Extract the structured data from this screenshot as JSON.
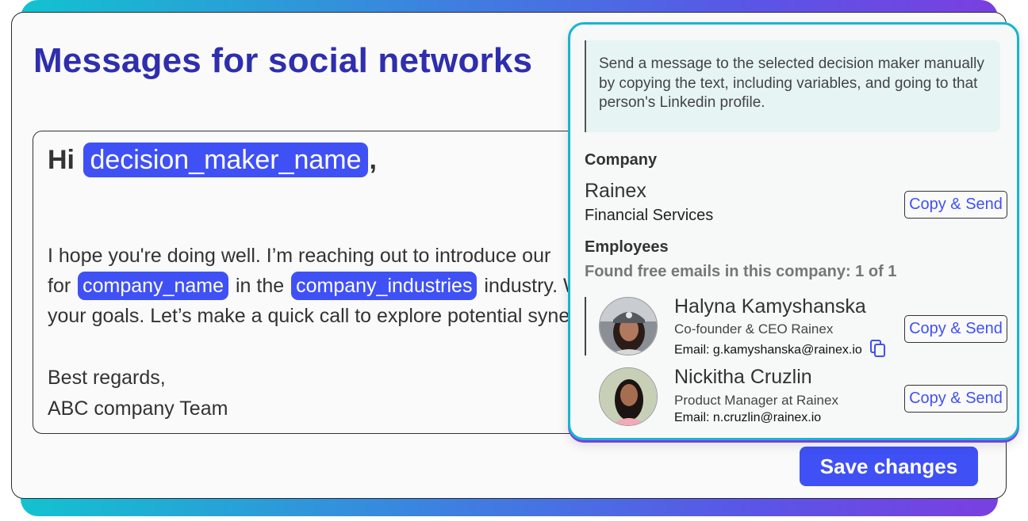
{
  "page": {
    "title": "Messages for social networks"
  },
  "editor": {
    "greeting_prefix": "Hi",
    "greeting_variable": "decision_maker_name",
    "greeting_suffix": ",",
    "line1": "I hope you're doing well. I’m reaching out to introduce our",
    "line2_prefix": "for",
    "line2_var1": "company_name",
    "line2_middle": "in the",
    "line2_var2": "company_industries",
    "line2_suffix": " industry. We can help you achieve",
    "line3": "your goals. Let’s make a quick call to explore potential synergies.",
    "signoff": "Best regards,",
    "signature": "ABC company Team"
  },
  "actions": {
    "save_label": "Save changes"
  },
  "panel": {
    "hint": "Send a message to the selected decision maker manually by copying the text, including variables, and going to that person's Linkedin profile.",
    "company_label": "Company",
    "company_name": "Rainex",
    "company_industry": "Financial Services",
    "copy_send_label": "Copy & Send",
    "employees_label": "Employees",
    "found_text": "Found free emails in this company: 1 of 1",
    "employees": [
      {
        "name": "Halyna Kamyshanska",
        "role": "Co-founder & CEO Rainex",
        "email_label": "Email:",
        "email": "g.kamyshanska@rainex.io",
        "copy_send_label": "Copy & Send"
      },
      {
        "name": "Nickitha Cruzlin",
        "role": "Product Manager at Rainex",
        "email_label": "Email:",
        "email": "n.cruzlin@rainex.io",
        "copy_send_label": "Copy & Send"
      }
    ]
  },
  "colors": {
    "accent": "#3f51f5",
    "title": "#2e2eae",
    "panel_border": "#16b6cf",
    "hint_bg": "#e6f4f4"
  },
  "icons": {
    "copy": "copy-icon"
  }
}
